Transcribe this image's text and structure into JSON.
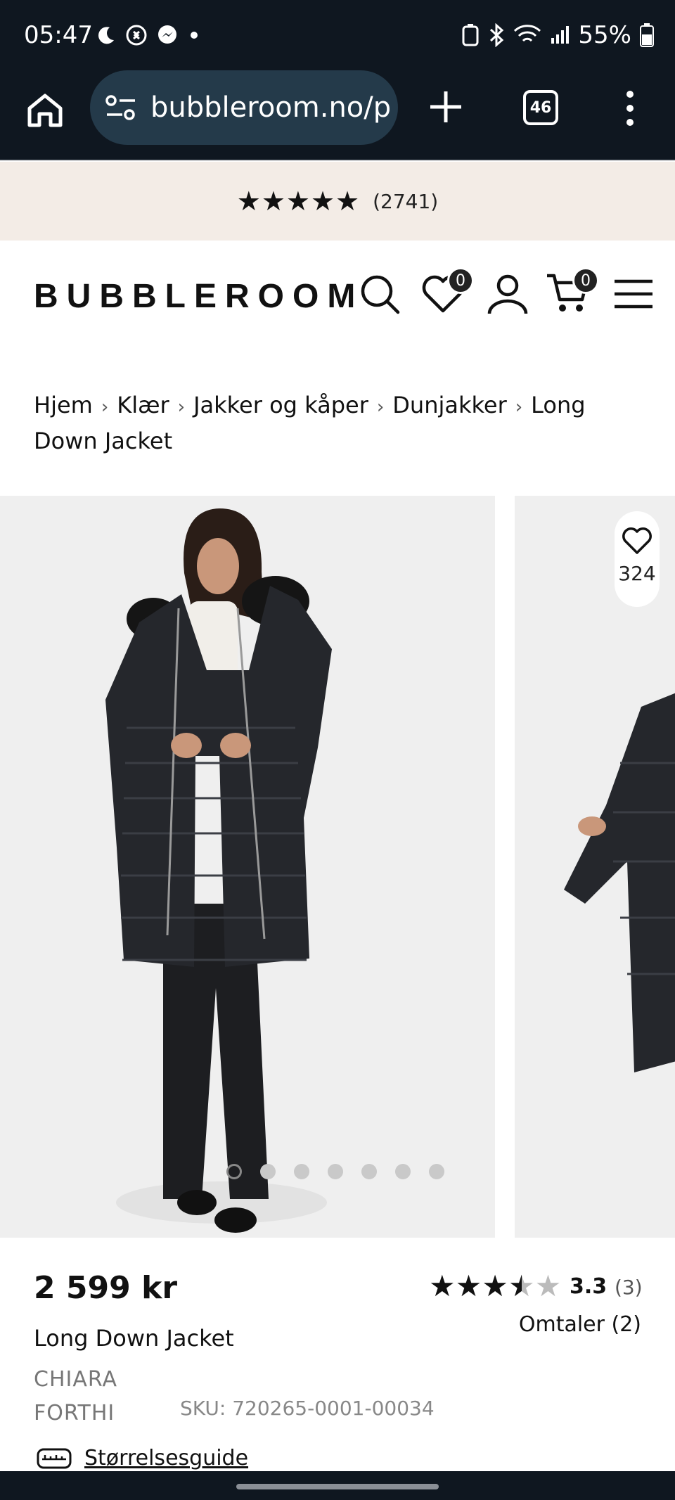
{
  "status_bar": {
    "time": "05:47",
    "battery": "55%"
  },
  "browser": {
    "url": "bubbleroom.no/p",
    "tab_count": "46"
  },
  "rating_banner": {
    "stars": "★★★★★",
    "count": "(2741)"
  },
  "header": {
    "logo": "BUBBLEROOM",
    "wishlist_count": "0",
    "cart_count": "0"
  },
  "breadcrumb": {
    "items": [
      "Hjem",
      "Klær",
      "Jakker og kåper",
      "Dunjakker",
      "Long Down Jacket"
    ],
    "separator": "›"
  },
  "gallery": {
    "favorite_count": "324",
    "dot_count": 7,
    "active_dot": 0
  },
  "product": {
    "price": "2 599 kr",
    "name": "Long Down Jacket",
    "brand": "CHIARA FORTHI",
    "sku": "SKU: 720265-0001-00034",
    "rating_score": "3.3",
    "rating_count": "(3)",
    "rating_value": 3.3,
    "reviews_link": "Omtaler (2)",
    "size_guide": "Størrelsesguide"
  },
  "colors": {
    "status_bg": "#0f1720",
    "url_pill": "#243a4a",
    "banner_bg": "#f3ece6",
    "image_bg": "#efefef"
  }
}
